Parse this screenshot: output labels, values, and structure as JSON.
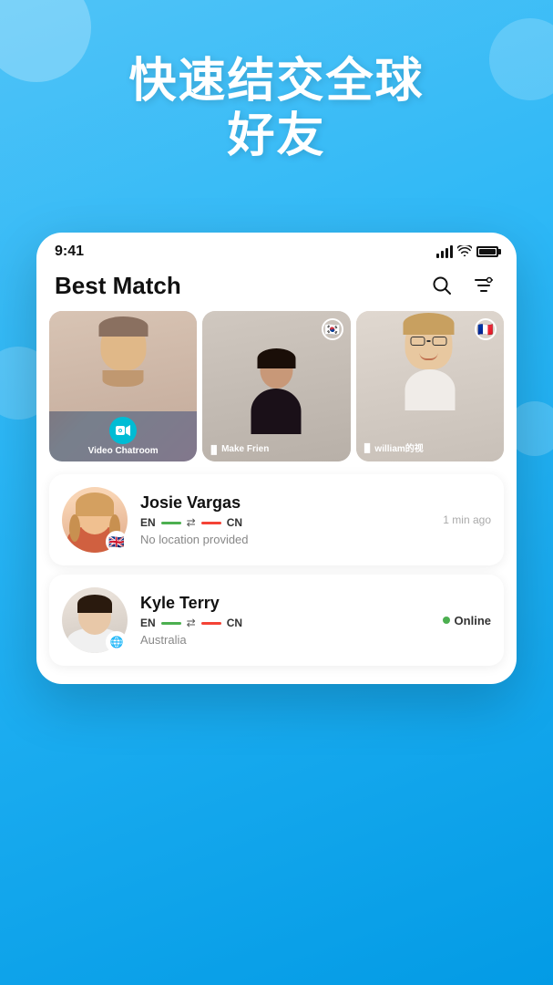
{
  "background": {
    "gradient_start": "#4fc3f7",
    "gradient_end": "#039be5"
  },
  "hero": {
    "line1": "快速结交全球",
    "line2": "好友"
  },
  "status_bar": {
    "time": "9:41",
    "signal_label": "signal",
    "wifi_label": "wifi",
    "battery_label": "battery"
  },
  "header": {
    "title": "Best Match",
    "search_icon": "🔍",
    "filter_icon": "⊟"
  },
  "video_cards": [
    {
      "id": "card-video-chatroom",
      "icon": "📹",
      "label": "Video Chatroom",
      "flag": null
    },
    {
      "id": "card-make-friends",
      "icon": "🎵",
      "label": "Make Frien",
      "flag": "🇰🇷"
    },
    {
      "id": "card-william",
      "icon": "🎵",
      "label": "william的视",
      "flag": "🇫🇷"
    }
  ],
  "users": [
    {
      "id": "josie-vargas",
      "name": "Josie Vargas",
      "lang_from": "EN",
      "lang_from_color": "#4caf50",
      "lang_to": "CN",
      "lang_to_color": "#f44336",
      "location": "No location provided",
      "time_ago": "1 min ago",
      "online": false,
      "flag": "🇬🇧",
      "avatar_bg": "#f5c8a8"
    },
    {
      "id": "kyle-terry",
      "name": "Kyle Terry",
      "lang_from": "EN",
      "lang_from_color": "#4caf50",
      "lang_to": "CN",
      "lang_to_color": "#f44336",
      "location": "Australia",
      "time_ago": "",
      "online": true,
      "flag": "🌐",
      "avatar_bg": "#e8e0d8"
    }
  ]
}
